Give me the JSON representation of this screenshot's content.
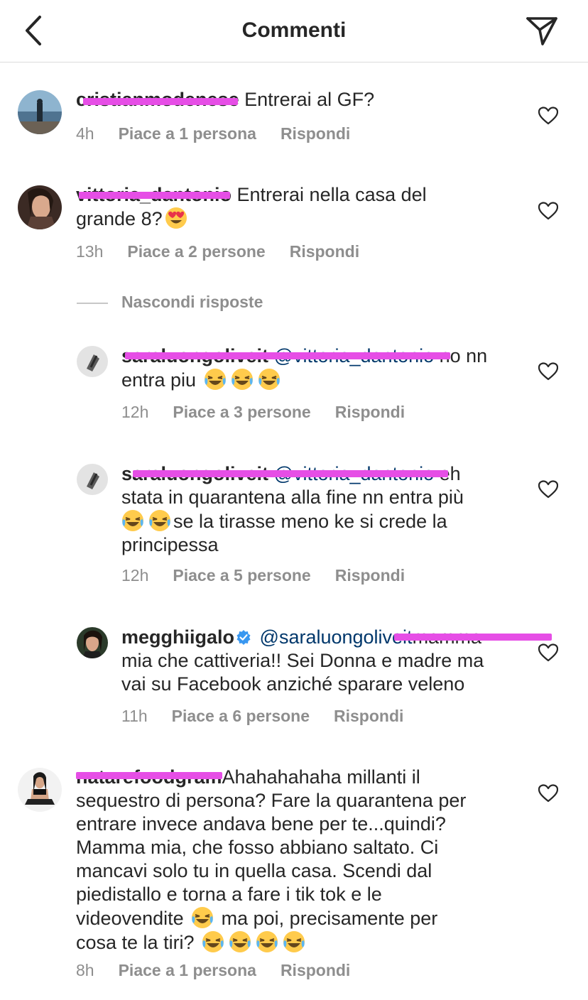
{
  "header": {
    "title": "Commenti"
  },
  "comments": [
    {
      "username": "cristianmodenese",
      "text": " Entrerai al GF?",
      "time": "4h",
      "likes": "Piace a 1 persona",
      "reply": "Rispondi"
    },
    {
      "username": "vittoria_dantonio",
      "text_line1": " Entrerai nella casa del",
      "text_line2": "grande 8?",
      "time": "13h",
      "likes": "Piace a 2 persone",
      "reply": "Rispondi"
    },
    {
      "username": "natarefoodgram",
      "line1": "Ahahahahaha millanti il",
      "line2": "sequestro di persona? Fare la quarantena per",
      "line3": "entrare invece andava bene per te...quindi?",
      "line4": "Mamma mia, che fosso abbiano saltato. Ci",
      "line5": "mancavi solo tu in quella casa. Scendi dal",
      "line6": "piedistallo e torna a fare i tik tok e le",
      "line7a": "videovendite",
      "line7b": " ma poi, precisamente per",
      "line8": "cosa te la tiri?",
      "time": "8h",
      "likes": "Piace a 1 persona",
      "reply": "Rispondi"
    }
  ],
  "hide_replies": "Nascondi risposte",
  "replies": [
    {
      "username": "saraluongoliveit",
      "mention": "@vittoria_dantonio",
      "text_line1": " no nn",
      "text_line2": "entra piu",
      "time": "12h",
      "likes": "Piace a 3 persone",
      "reply": "Rispondi"
    },
    {
      "username": "saraluongoliveit",
      "mention": "@vittoria_dantonio",
      "text_line1": " eh",
      "text_line2": "stata in quarantena alla fine nn entra più",
      "text_line3": "se la tirasse meno ke si crede la",
      "text_line4": "principessa",
      "time": "12h",
      "likes": "Piace a 5 persone",
      "reply": "Rispondi"
    },
    {
      "username": "megghiigalo",
      "mention": "@saraluongoliveit",
      "text_line1": "mamma",
      "text_line2": "mia che cattiveria!! Sei Donna e madre ma",
      "text_line3": "vai su Facebook anziché sparare veleno",
      "time": "11h",
      "likes": "Piace a 6 persone",
      "reply": "Rispondi"
    }
  ],
  "icons": {
    "back": "chevron-left-icon",
    "send": "paper-plane-icon",
    "like": "heart-outline-icon",
    "verified": "verified-badge-icon",
    "emoji_laugh": "face-with-tears-of-joy",
    "emoji_love": "smiling-face-with-heart-eyes"
  },
  "colors": {
    "text": "#262626",
    "meta": "#8e8e8e",
    "mention": "#00376b",
    "redaction": "#e64ee6",
    "verified": "#3897f0",
    "divider": "#dbdbdb"
  }
}
